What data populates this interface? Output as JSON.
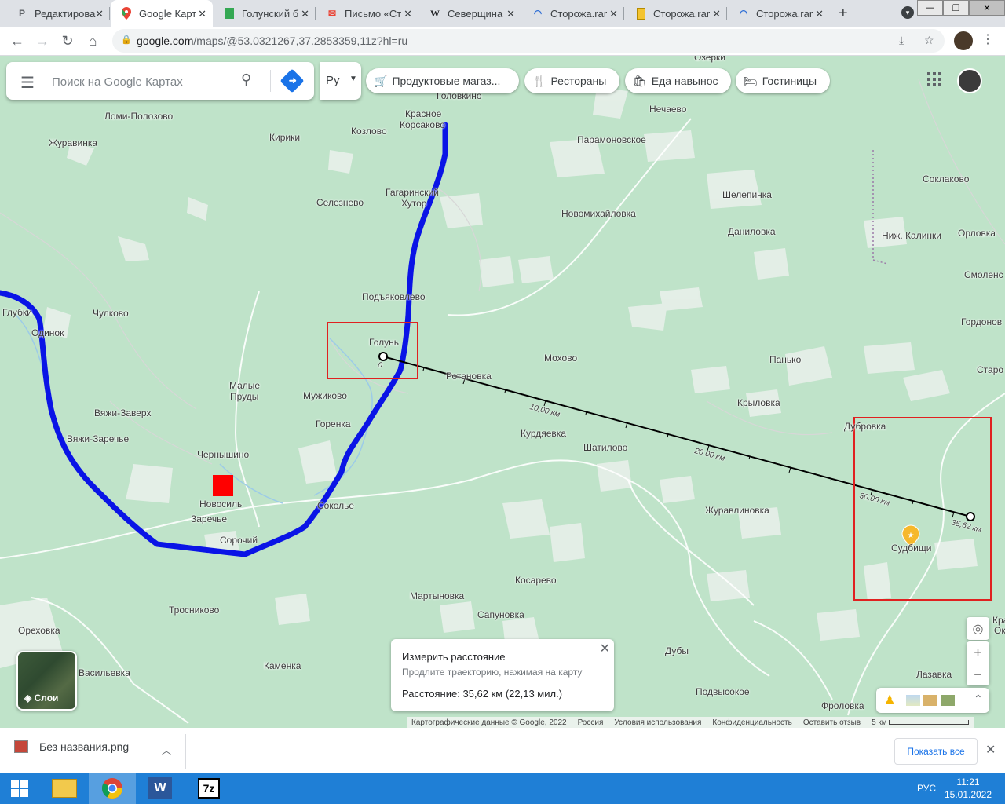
{
  "browser": {
    "tabs": [
      {
        "label": "Редактирова",
        "icon": "P"
      },
      {
        "label": "Google Карт",
        "icon": "maps"
      },
      {
        "label": "Голунский б",
        "icon": "sheets"
      },
      {
        "label": "Письмо «Ст",
        "icon": "gmail"
      },
      {
        "label": "Северщина",
        "icon": "W"
      },
      {
        "label": "Сторожа.rar",
        "icon": "cloud"
      },
      {
        "label": "Сторожа.rar",
        "icon": "doc"
      },
      {
        "label": "Сторожа.rar",
        "icon": "cloud"
      }
    ],
    "url_host": "google.com",
    "url_path": "/maps/@53.0321267,37.2853359,11z?hl=ru",
    "window": {
      "minimize": "—",
      "maximize": "❐",
      "close": "✕"
    }
  },
  "maps": {
    "search_placeholder": "Поиск на Google Картах",
    "lang_value": "Ру",
    "chips": [
      "Продуктовые магаз...",
      "Рестораны",
      "Еда навынос",
      "Гостиницы"
    ],
    "layers_label": "Слои",
    "measure": {
      "title": "Измерить расстояние",
      "hint": "Продлите траекторию, нажимая на карту",
      "distance": "Расстояние: 35,62 км (22,13 мил.)"
    },
    "attribution": [
      "Картографические данные © Google, 2022",
      "Россия",
      "Условия использования",
      "Конфиденциальность",
      "Оставить отзыв",
      "5 км"
    ],
    "route_labels": [
      "0",
      "10,00 км",
      "20,00 км",
      "30,00 км",
      "35,62 км"
    ],
    "places": [
      "Ломи-Полозово",
      "Журавинка",
      "Кирики",
      "Козлово",
      "Красное",
      "Корсаково",
      "Головкино",
      "Озерки",
      "Нечаево",
      "Парамоновское",
      "Гагаринский",
      "Хутор",
      "Селезнево",
      "Новомихайловка",
      "Шелепинка",
      "Соклаково",
      "Даниловка",
      "Ниж. Калинки",
      "Орловка",
      "Смоленс",
      "Подъяковлево",
      "Глубки",
      "Чулково",
      "Одинок",
      "Голунь",
      "Гордонов",
      "Мохово",
      "Ротановка",
      "Панько",
      "Старо",
      "Малые",
      "Пруды",
      "Мужиково",
      "Крыловка",
      "Вяжи-Заверх",
      "Вяжи-Заречье",
      "Горенка",
      "Дубровка",
      "Курдяевка",
      "Шатилово",
      "Чернышино",
      "Новосиль",
      "Заречье",
      "Соколье",
      "Журавлиновка",
      "Сорочий",
      "Судбищи",
      "Косарево",
      "Мартыновка",
      "Тросниково",
      "Сапуновка",
      "Ореховка",
      "Васильевка",
      "Каменка",
      "Дубы",
      "Кра",
      "Ок",
      "Лазавка",
      "Подвысокое",
      "Фроловка"
    ],
    "place_extra": {
      "mohovoe": "Мохоое",
      "pankovo": "Панько",
      "podyak": "Подъяковлево"
    }
  },
  "downloads": {
    "file": "Без названия.png",
    "show_all": "Показать все"
  },
  "taskbar": {
    "lang": "РУС",
    "time": "11:21",
    "date": "15.01.2022"
  }
}
